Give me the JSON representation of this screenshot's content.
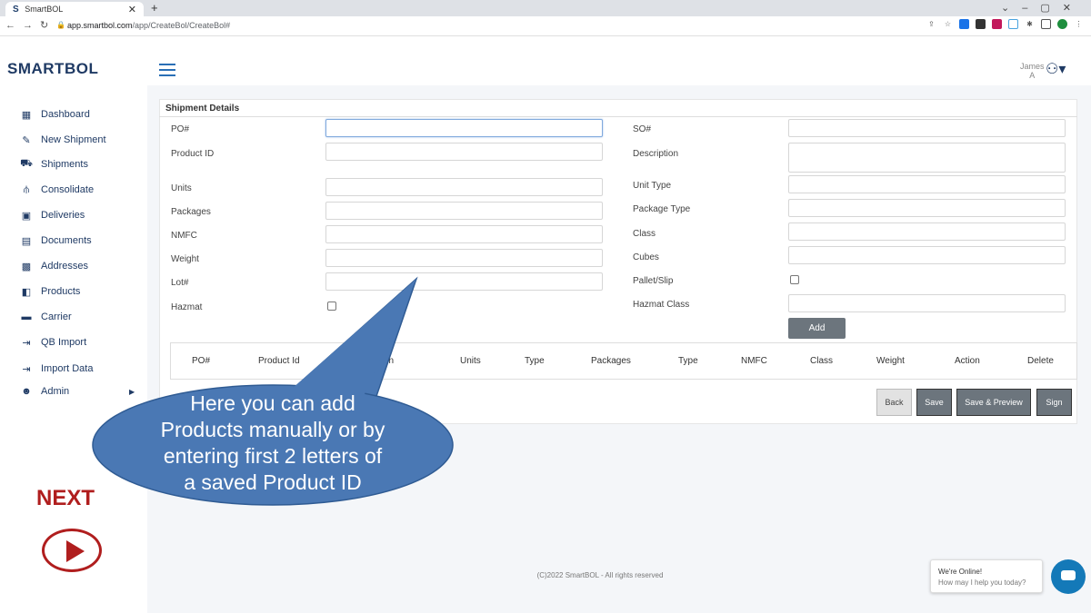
{
  "browser": {
    "tab_title": "SmartBOL",
    "tab_logo": "S",
    "url_host": "app.smartbol.com",
    "url_path": "/app/CreateBol/CreateBol#"
  },
  "app": {
    "logo": "SMARTBOL",
    "user_first": "James",
    "user_last": "A"
  },
  "sidebar": {
    "items": [
      {
        "label": "Dashboard",
        "icon": "grid-icon"
      },
      {
        "label": "New Shipment",
        "icon": "edit-icon"
      },
      {
        "label": "Shipments",
        "icon": "truck-icon"
      },
      {
        "label": "Consolidate",
        "icon": "sitemap-icon"
      },
      {
        "label": "Deliveries",
        "icon": "box-icon"
      },
      {
        "label": "Documents",
        "icon": "document-icon"
      },
      {
        "label": "Addresses",
        "icon": "address-card-icon"
      },
      {
        "label": "Products",
        "icon": "product-icon"
      },
      {
        "label": "Carrier",
        "icon": "carrier-icon"
      },
      {
        "label": "QB Import",
        "icon": "import-icon"
      },
      {
        "label": "Import Data",
        "icon": "import-icon"
      },
      {
        "label": "Admin",
        "icon": "users-icon"
      }
    ],
    "next_label": "NEXT"
  },
  "form": {
    "title": "Shipment Details",
    "left_labels": [
      "PO#",
      "Product ID",
      "Units",
      "Packages",
      "NMFC",
      "Weight",
      "Lot#",
      "Hazmat"
    ],
    "right_labels": [
      "SO#",
      "Description",
      "Unit Type",
      "Package Type",
      "Class",
      "Cubes",
      "Pallet/Slip",
      "Hazmat Class"
    ],
    "add_label": "Add"
  },
  "table": {
    "headers": [
      "PO#",
      "Product Id",
      "Description",
      "Units",
      "Type",
      "Packages",
      "Type",
      "NMFC",
      "Class",
      "Weight",
      "Action",
      "Delete"
    ]
  },
  "actions": {
    "back": "Back",
    "save": "Save",
    "save_preview": "Save & Preview",
    "sign": "Sign"
  },
  "footer": "(C)2022 SmartBOL - All rights reserved",
  "chat": {
    "title": "We're Online!",
    "subtitle": "How may I help you today?"
  },
  "callout": {
    "lines": [
      "Here you can add",
      "Products manually or by",
      "entering first 2 letters of",
      "a saved Product ID"
    ]
  }
}
